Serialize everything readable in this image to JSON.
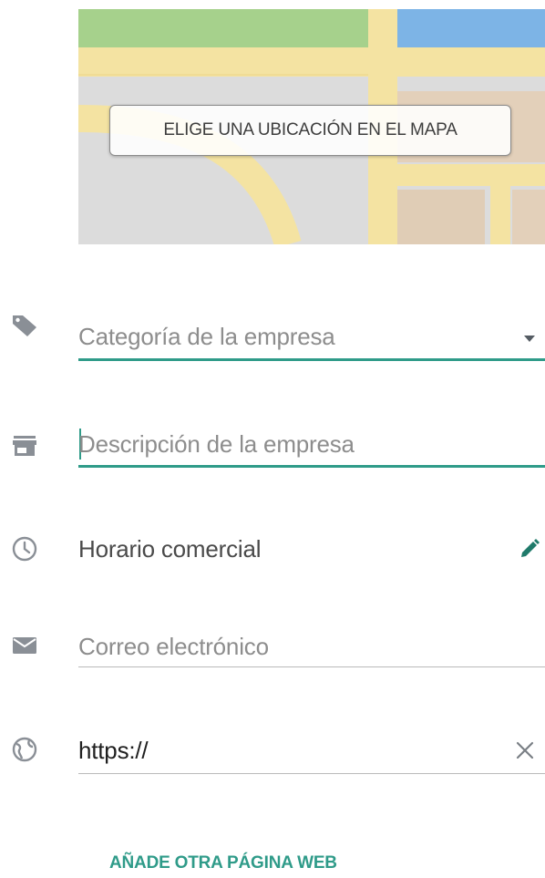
{
  "map": {
    "button_label": "ELIGE UNA UBICACIÓN EN EL MAPA",
    "colors": {
      "park": "#9ecf85",
      "water": "#7ab5e8",
      "road": "#f4e3a2",
      "ground": "#dedede",
      "building": "#e2cfb8"
    }
  },
  "form": {
    "category": {
      "icon": "tag-icon",
      "placeholder": "Categoría de la empresa",
      "trailing_icon": "dropdown-arrow-icon"
    },
    "description": {
      "icon": "store-icon",
      "placeholder": "Descripción de la empresa"
    },
    "hours": {
      "icon": "clock-icon",
      "label": "Horario comercial",
      "trailing_icon": "pencil-icon"
    },
    "email": {
      "icon": "envelope-icon",
      "placeholder": "Correo electrónico"
    },
    "website": {
      "icon": "globe-icon",
      "value": "https://",
      "trailing_icon": "clear-icon"
    }
  },
  "actions": {
    "add_website_label": "AÑADE OTRA PÁGINA WEB"
  },
  "colors": {
    "accent": "#2f9b89",
    "icon_gray": "#8a8f96",
    "hint_text": "#8d8d8d"
  }
}
